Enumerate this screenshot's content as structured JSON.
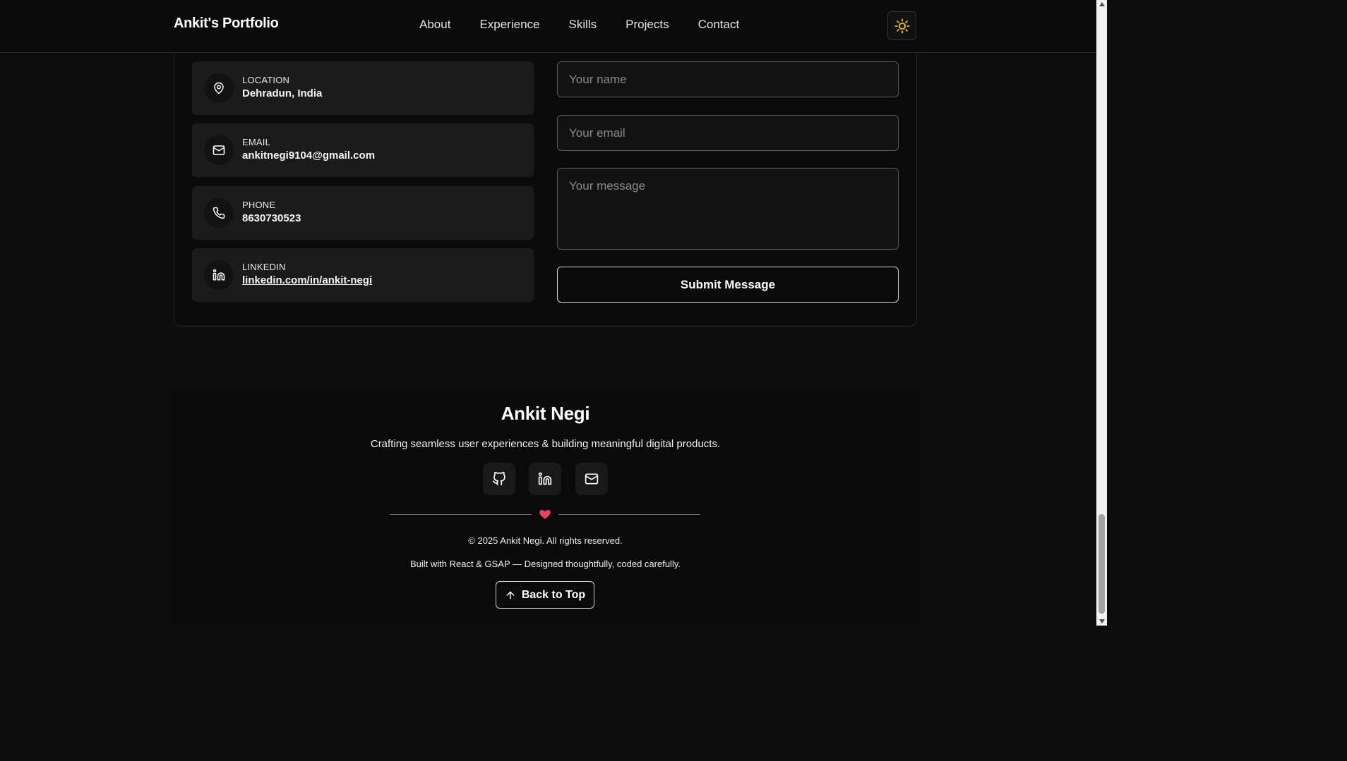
{
  "header": {
    "brand": "Ankit's Portfolio",
    "nav": [
      "About",
      "Experience",
      "Skills",
      "Projects",
      "Contact"
    ],
    "theme_icon": "sun-icon",
    "theme_icon_color": "#f5c518"
  },
  "contact": {
    "items": [
      {
        "icon": "map-pin-icon",
        "label": "LOCATION",
        "value": "Dehradun, India"
      },
      {
        "icon": "mail-icon",
        "label": "EMAIL",
        "value": "ankitnegi9104@gmail.com"
      },
      {
        "icon": "phone-icon",
        "label": "PHONE",
        "value": "8630730523"
      },
      {
        "icon": "linkedin-icon",
        "label": "LINKEDIN",
        "value": "linkedin.com/in/ankit-negi"
      }
    ],
    "form": {
      "name_placeholder": "Your name",
      "email_placeholder": "Your email",
      "message_placeholder": "Your message",
      "submit_label": "Submit Message"
    }
  },
  "footer": {
    "name": "Ankit Negi",
    "tagline": "Crafting seamless user experiences & building meaningful digital products.",
    "socials": [
      "github-icon",
      "linkedin-icon",
      "mail-icon"
    ],
    "heart_color": "#f43f5e",
    "copyright": "© 2025 Ankit Negi. All rights reserved.",
    "built_with": "Built with React & GSAP — Designed thoughtfully, coded carefully.",
    "back_to_top": "Back to Top"
  }
}
